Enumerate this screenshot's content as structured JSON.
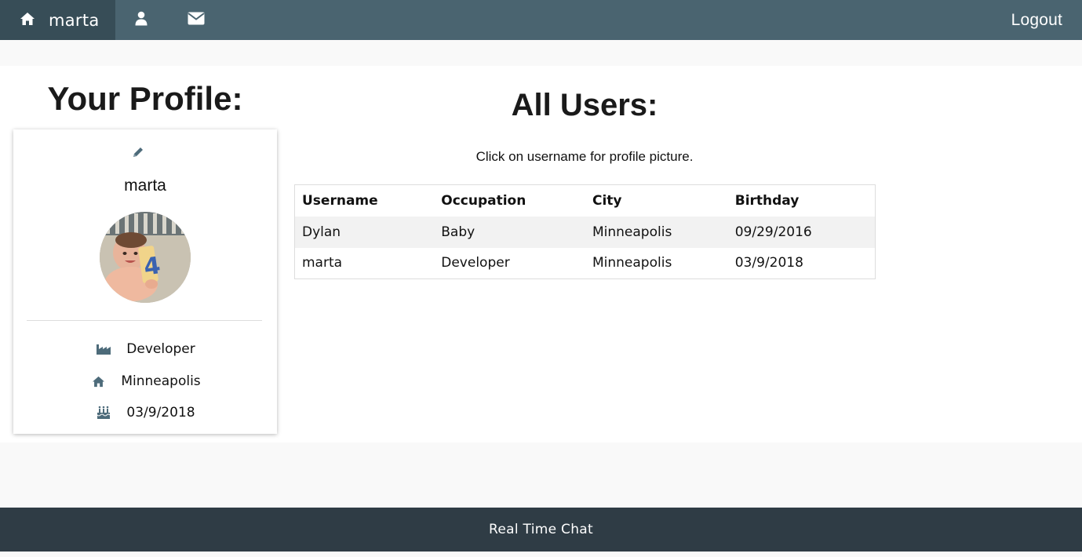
{
  "nav": {
    "home_icon": "home-icon",
    "username": "marta",
    "profile_icon": "user-icon",
    "messages_icon": "envelope-icon",
    "logout_label": "Logout"
  },
  "profile": {
    "heading": "Your Profile:",
    "edit_icon": "pencil-icon",
    "name": "marta",
    "avatar": "profile-photo",
    "occupation": "Developer",
    "city": "Minneapolis",
    "birthday": "03/9/2018"
  },
  "users": {
    "heading": "All Users:",
    "hint": "Click on username for profile picture.",
    "columns": [
      "Username",
      "Occupation",
      "City",
      "Birthday"
    ],
    "rows": [
      [
        "Dylan",
        "Baby",
        "Minneapolis",
        "09/29/2016"
      ],
      [
        "marta",
        "Developer",
        "Minneapolis",
        "03/9/2018"
      ]
    ]
  },
  "footer": {
    "text": "Real Time Chat"
  },
  "colors": {
    "nav_bg": "#4a6470",
    "nav_active": "#374d57",
    "footer_bg": "#2f3c45",
    "icon_accent": "#4d6b7a"
  }
}
